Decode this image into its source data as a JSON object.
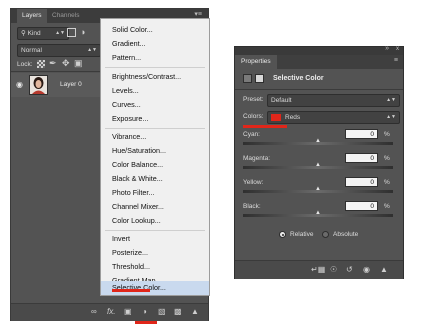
{
  "layers_panel": {
    "tabs": [
      "Layers",
      "Channels"
    ],
    "menu_glyph": "▾≡",
    "filter_kind": "Kind",
    "blend_mode": "Normal",
    "lock_label": "Lock:",
    "layer_name": "Layer 0",
    "bottom_icons": [
      "link-icon",
      "fx-icon",
      "mask-icon",
      "adjustment-icon",
      "folder-icon",
      "new-layer-icon",
      "trash-icon"
    ],
    "fx_label": "fx."
  },
  "adjustment_menu": {
    "groups": [
      [
        "Solid Color...",
        "Gradient...",
        "Pattern..."
      ],
      [
        "Brightness/Contrast...",
        "Levels...",
        "Curves...",
        "Exposure..."
      ],
      [
        "Vibrance...",
        "Hue/Saturation...",
        "Color Balance...",
        "Black & White...",
        "Photo Filter...",
        "Channel Mixer...",
        "Color Lookup..."
      ],
      [
        "Invert",
        "Posterize...",
        "Threshold...",
        "Gradient Map...",
        "Selective Color..."
      ]
    ],
    "highlighted": "Selective Color..."
  },
  "properties_panel": {
    "title": "Properties",
    "header_double_arrow": "»",
    "header_close": "x",
    "menu_glyph": "≡",
    "adjustment_title": "Selective Color",
    "preset_label": "Preset:",
    "preset_value": "Default",
    "colors_label": "Colors:",
    "colors_value": "Reds",
    "colors_swatch": "#e0261a",
    "sliders": [
      {
        "label": "Cyan:",
        "value": "0",
        "unit": "%"
      },
      {
        "label": "Magenta:",
        "value": "0",
        "unit": "%"
      },
      {
        "label": "Yellow:",
        "value": "0",
        "unit": "%"
      },
      {
        "label": "Black:",
        "value": "0",
        "unit": "%"
      }
    ],
    "method_options": [
      "Relative",
      "Absolute"
    ],
    "method_selected": "Relative"
  },
  "colors": {
    "accent_red": "#e0261a",
    "panel_bg": "#535353",
    "menu_highlight": "#c9d9ee"
  }
}
